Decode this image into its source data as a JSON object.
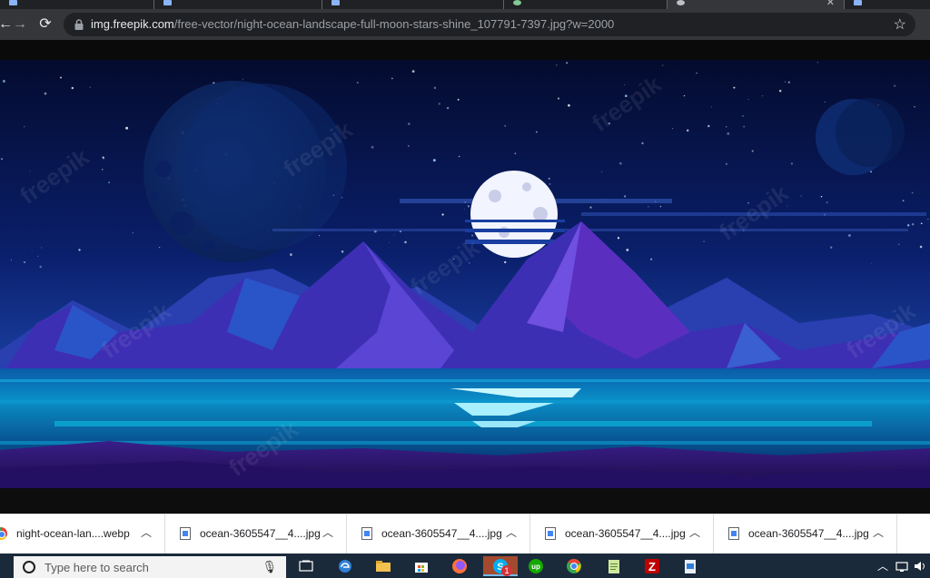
{
  "browser": {
    "address": {
      "host": "img.freepik.com",
      "path": "/free-vector/night-ocean-landscape-full-moon-stars-shine_107791-7397.jpg?w=2000"
    }
  },
  "image": {
    "watermark": "freepik",
    "colors": {
      "sky_top": "#040b2e",
      "sky_bottom": "#1a3fa0",
      "moon": "#f2f4ff",
      "mountain": "#5a2fc0",
      "water": "#00c8e6"
    }
  },
  "downloads": [
    {
      "name": "night-ocean-lan....webp",
      "type": "chrome-file-icon"
    },
    {
      "name": "ocean-3605547__4....jpg",
      "type": "image-file-icon"
    },
    {
      "name": "ocean-3605547__4....jpg",
      "type": "image-file-icon"
    },
    {
      "name": "ocean-3605547__4....jpg",
      "type": "image-file-icon"
    },
    {
      "name": "ocean-3605547__4....jpg",
      "type": "image-file-icon"
    }
  ],
  "taskbar": {
    "search_placeholder": "Type here to search",
    "skype_badge": "1",
    "apps": [
      "task-view-icon",
      "edge-icon",
      "file-explorer-icon",
      "store-icon",
      "firefox-icon",
      "skype-icon",
      "upwork-icon",
      "chrome-icon",
      "notepad-icon",
      "filezilla-icon",
      "photos-icon"
    ]
  }
}
